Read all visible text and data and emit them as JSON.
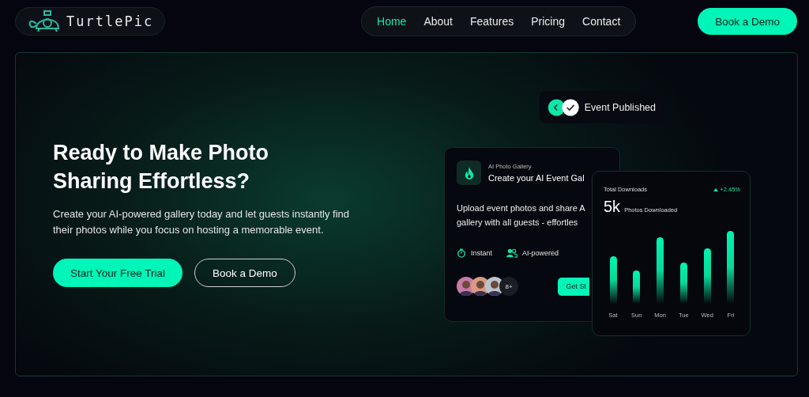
{
  "brand": {
    "name": "TurtlePic"
  },
  "nav": [
    {
      "label": "Home",
      "selected": true
    },
    {
      "label": "About",
      "selected": false
    },
    {
      "label": "Features",
      "selected": false
    },
    {
      "label": "Pricing",
      "selected": false
    },
    {
      "label": "Contact",
      "selected": false
    }
  ],
  "header_button": "Book a Demo",
  "hero": {
    "title": "Ready to Make Photo Sharing Effortless?",
    "text": "Create your AI-powered gallery today and let guests instantly find their photos while you focus on hosting a memorable event.",
    "buttons": [
      {
        "label": "Start Your Free Trial",
        "kind": "primary"
      },
      {
        "label": "Book a Demo",
        "kind": "outline"
      }
    ]
  },
  "notification": {
    "text": "Event Published"
  },
  "gallery_card": {
    "eyebrow": "AI Photo Gallery",
    "title": "Create your AI Event Gal",
    "text_lines": [
      "Upload event photos and share A",
      "gallery with all guests - effortles"
    ],
    "features": [
      {
        "label": "Instant",
        "kind": "timer"
      },
      {
        "label": "AI-powered",
        "kind": "people"
      }
    ],
    "avatars": [
      {
        "color": "#c77aa8"
      },
      {
        "color": "#d99a82"
      },
      {
        "color": "#b9c4cc"
      }
    ],
    "more_count": "8+",
    "button": "Get St"
  },
  "downloads_card": {
    "title": "Total Downloads",
    "change": "+2.45%",
    "value": "5k",
    "caption": "Photos Downloaded",
    "days": [
      "Sat",
      "Sun",
      "Mon",
      "Tue",
      "Wed",
      "Fri"
    ]
  }
}
